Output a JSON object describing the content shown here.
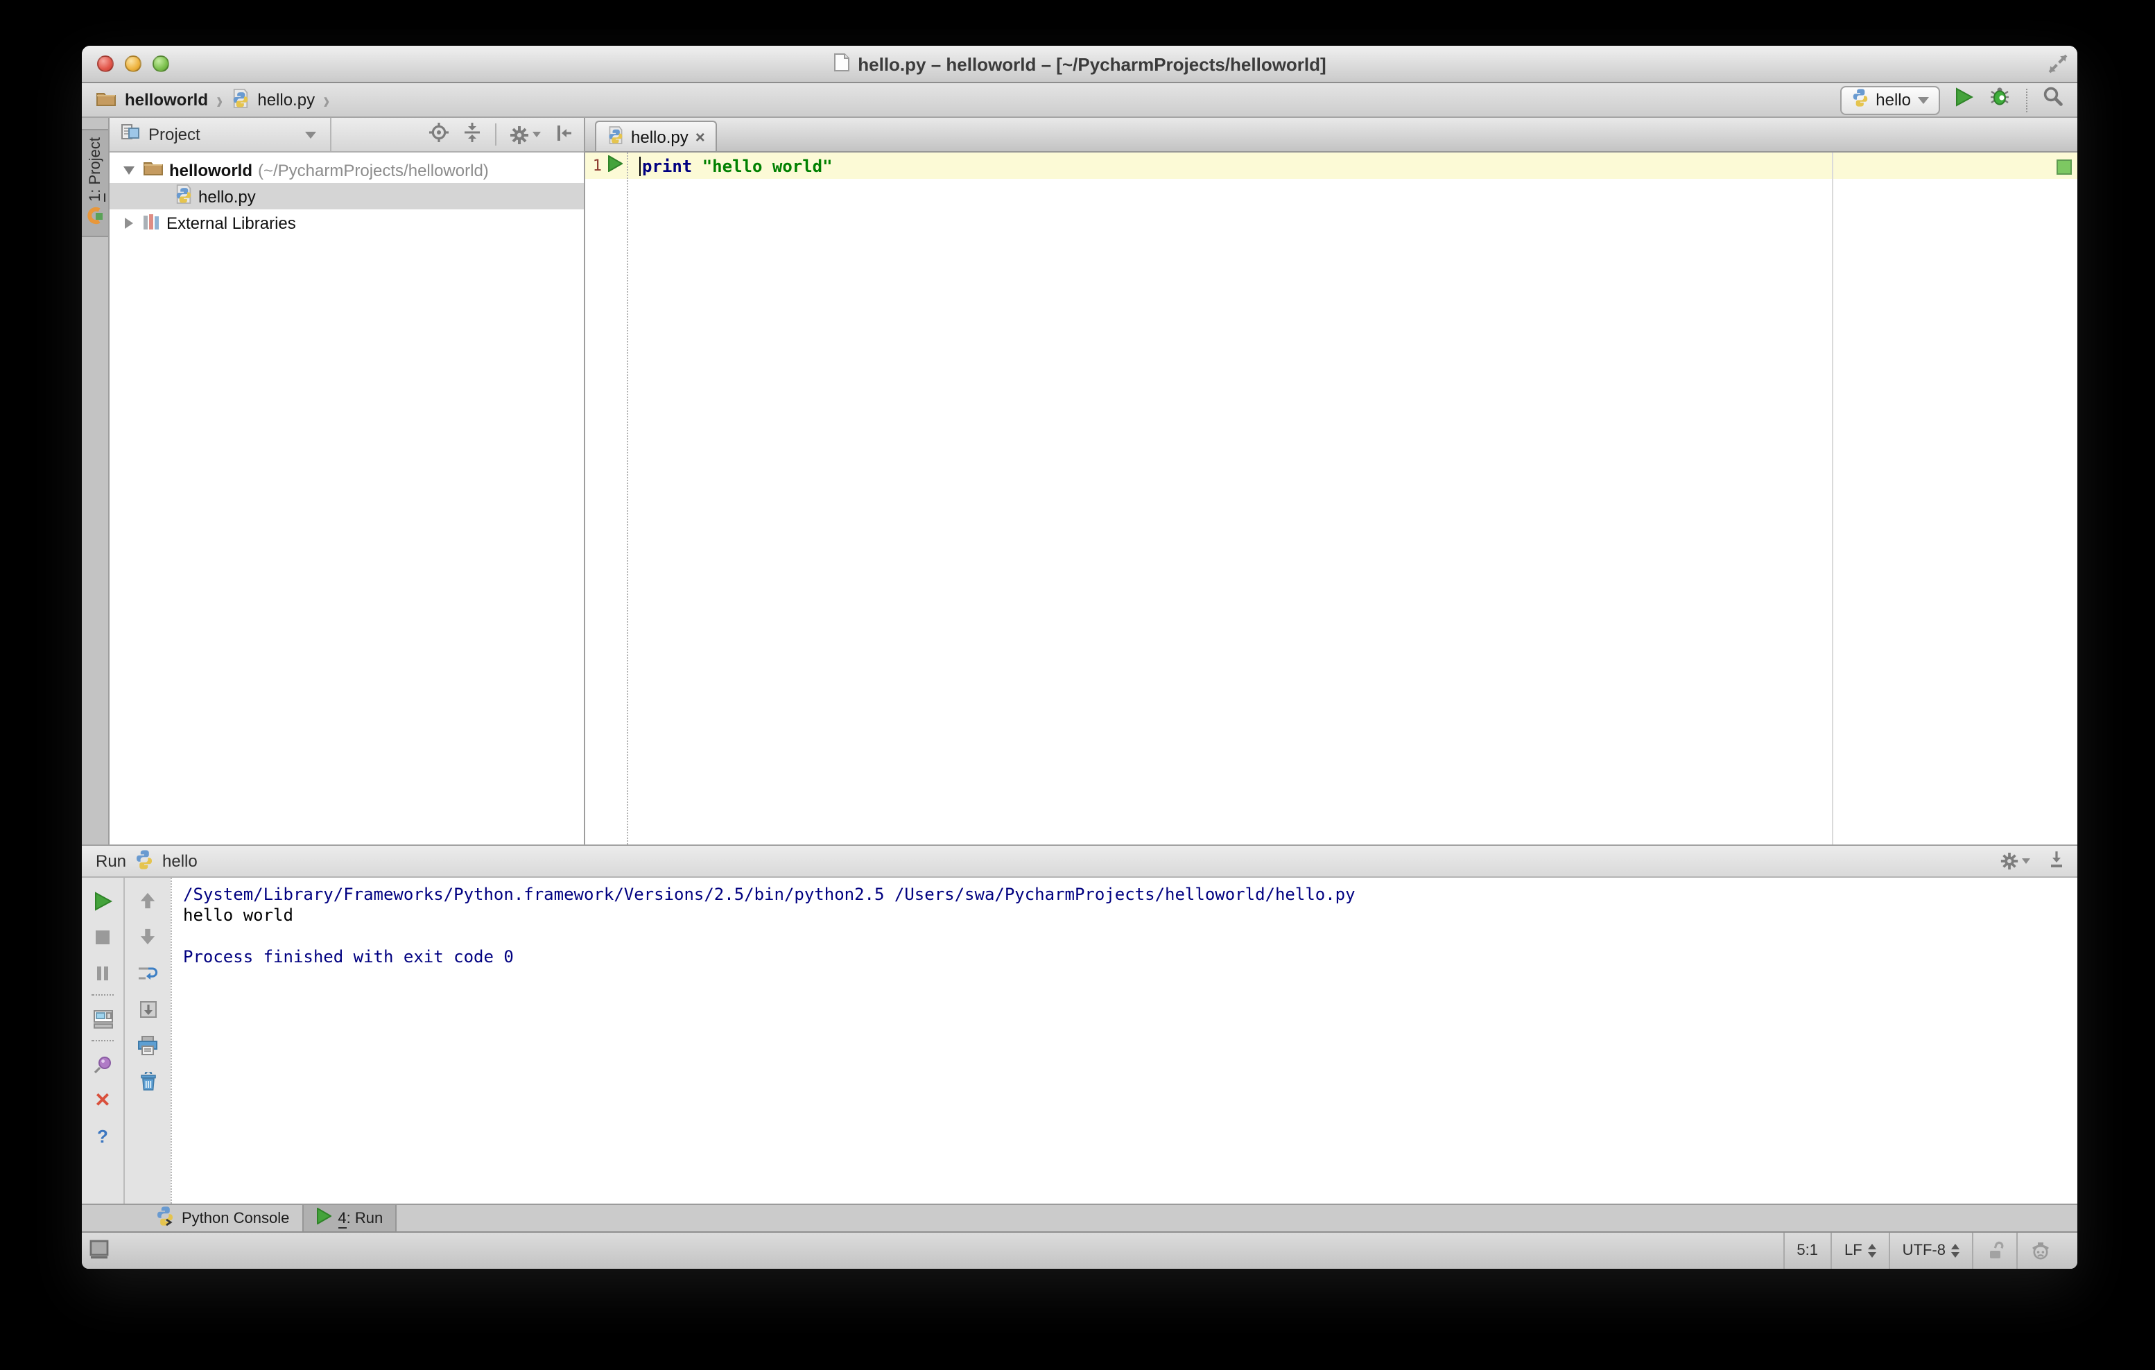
{
  "window": {
    "title": "hello.py – helloworld – [~/PycharmProjects/helloworld]"
  },
  "breadcrumbs": {
    "project": "helloworld",
    "file": "hello.py"
  },
  "run_config": {
    "selected": "hello"
  },
  "stripe": {
    "project_button_num": "1",
    "project_button_rest": ": Project"
  },
  "project_panel": {
    "header_label": "Project",
    "tree": [
      {
        "label": "helloworld",
        "path": " (~/PycharmProjects/helloworld)"
      },
      {
        "label": "hello.py"
      },
      {
        "label": "External Libraries"
      }
    ]
  },
  "editor": {
    "tab_label": "hello.py",
    "tab_close": "×",
    "line_number": "1",
    "code_keyword": "print",
    "code_string": "\"hello world\""
  },
  "run_panel": {
    "title": "Run",
    "config_name": "hello",
    "console_lines": [
      {
        "text": "/System/Library/Frameworks/Python.framework/Versions/2.5/bin/python2.5 /Users/swa/PycharmProjects/helloworld/hello.py"
      },
      {
        "text": "hello world"
      },
      {
        "text": ""
      },
      {
        "text": "Process finished with exit code 0"
      }
    ],
    "help_glyph": "?",
    "close_glyph": "✕"
  },
  "tool_window_bar": {
    "python_console_label": "Python Console",
    "run_tab_num": "4",
    "run_tab_rest": ": Run"
  },
  "status_bar": {
    "caret_position": "5:1",
    "line_separator": "LF",
    "encoding": "UTF-8"
  },
  "colors": {
    "keyword": "#000080",
    "string": "#008000",
    "console_info": "#000080",
    "current_line_bg": "#fcfad6",
    "run_green": "#44a33b",
    "selection_gray": "#d5d5d5"
  }
}
